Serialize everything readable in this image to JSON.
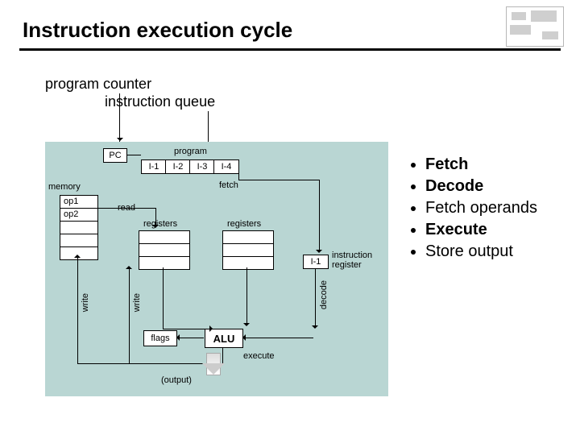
{
  "heading": "Instruction execution cycle",
  "annotations": {
    "program_counter": "program counter",
    "instruction_queue": "instruction queue"
  },
  "diagram": {
    "pc": "PC",
    "program": "program",
    "i1": "I-1",
    "i2": "I-2",
    "i3": "I-3",
    "i4": "I-4",
    "memory_label": "memory",
    "op1": "op1",
    "op2": "op2",
    "read": "read",
    "fetch": "fetch",
    "registers": "registers",
    "instruction_register": "instruction\nregister",
    "ir_i1": "I-1",
    "decode": "decode",
    "alu": "ALU",
    "flags": "flags",
    "execute": "execute",
    "write": "write",
    "output": "(output)"
  },
  "bullets": {
    "fetch": "Fetch",
    "decode": "Decode",
    "fetch_operands": "Fetch operands",
    "execute": "Execute",
    "store_output": "Store output"
  }
}
